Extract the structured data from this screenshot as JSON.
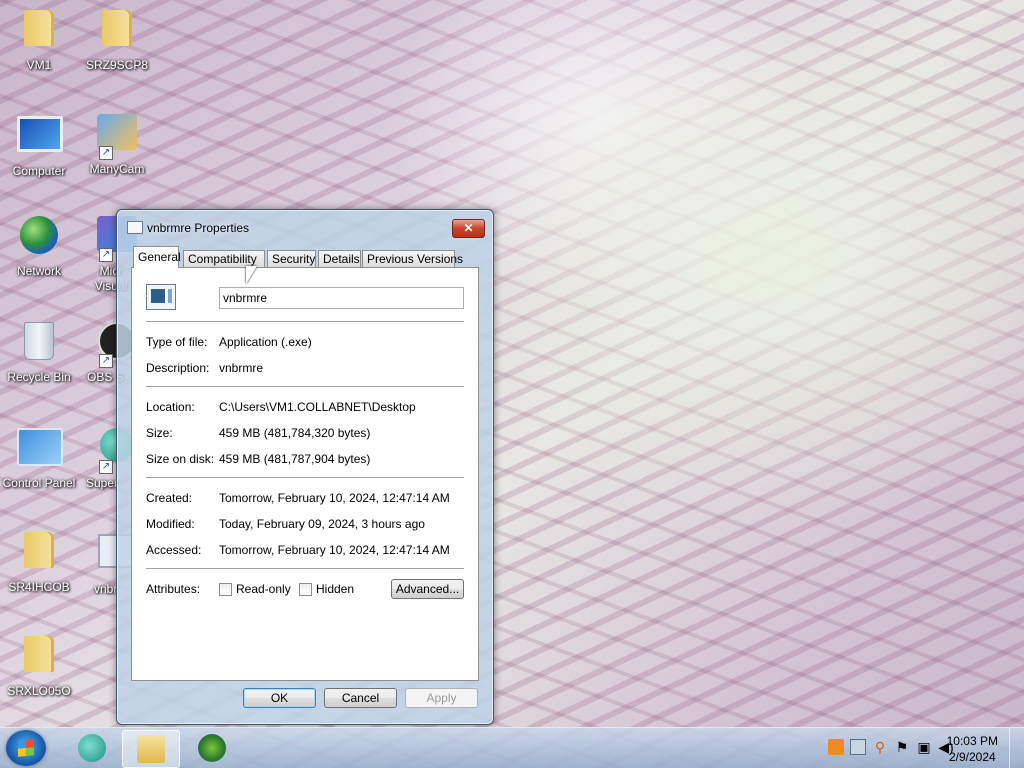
{
  "desktop": {
    "icons": [
      {
        "label": "VM1",
        "icon": "user-folder-icon"
      },
      {
        "label": "SRZ9SCP8",
        "icon": "folder-icon"
      },
      {
        "label": "Computer",
        "icon": "computer-icon"
      },
      {
        "label": "ManyCam",
        "icon": "manycam-icon"
      },
      {
        "label": "Network",
        "icon": "network-icon"
      },
      {
        "label": "Micr Visual",
        "icon": "visual-studio-icon"
      },
      {
        "label": "Recycle Bin",
        "icon": "recycle-bin-icon"
      },
      {
        "label": "OBS S",
        "icon": "obs-icon"
      },
      {
        "label": "Control Panel",
        "icon": "control-panel-icon"
      },
      {
        "label": "Super",
        "icon": "app-icon"
      },
      {
        "label": "SR4IHCOB",
        "icon": "folder-icon"
      },
      {
        "label": "vnbr",
        "icon": "exe-icon"
      },
      {
        "label": "SRXLO05O",
        "icon": "folder-icon"
      }
    ]
  },
  "dialog": {
    "title": "vnbrmre Properties",
    "close_label": "✕",
    "tabs": [
      {
        "label": "General",
        "active": true
      },
      {
        "label": "Compatibility",
        "active": false
      },
      {
        "label": "Security",
        "active": false
      },
      {
        "label": "Details",
        "active": false
      },
      {
        "label": "Previous Versions",
        "active": false
      }
    ],
    "file_name": "vnbrmre",
    "type_label": "Type of file:",
    "type_value": "Application (.exe)",
    "description_label": "Description:",
    "description_value": "vnbrmre",
    "location_label": "Location:",
    "location_value": "C:\\Users\\VM1.COLLABNET\\Desktop",
    "size_label": "Size:",
    "size_value": "459 MB (481,784,320 bytes)",
    "size_on_disk_label": "Size on disk:",
    "size_on_disk_value": "459 MB (481,787,904 bytes)",
    "created_label": "Created:",
    "created_value": "Tomorrow, February 10, 2024, 12:47:14 AM",
    "modified_label": "Modified:",
    "modified_value": "Today, February 09, 2024, 3 hours ago",
    "accessed_label": "Accessed:",
    "accessed_value": "Tomorrow, February 10, 2024, 12:47:14 AM",
    "attributes_label": "Attributes:",
    "readonly_label": "Read-only",
    "hidden_label": "Hidden",
    "advanced_label": "Advanced...",
    "ok_label": "OK",
    "cancel_label": "Cancel",
    "apply_label": "Apply"
  },
  "taskbar": {
    "items": [
      "start-button",
      "app-icon",
      "explorer-icon",
      "media-player-icon"
    ],
    "tray_icons": [
      "alert-icon",
      "network-share-icon",
      "search-icon",
      "flag-icon",
      "network-icon",
      "volume-icon"
    ],
    "time": "10:03 PM",
    "date": "2/9/2024"
  }
}
